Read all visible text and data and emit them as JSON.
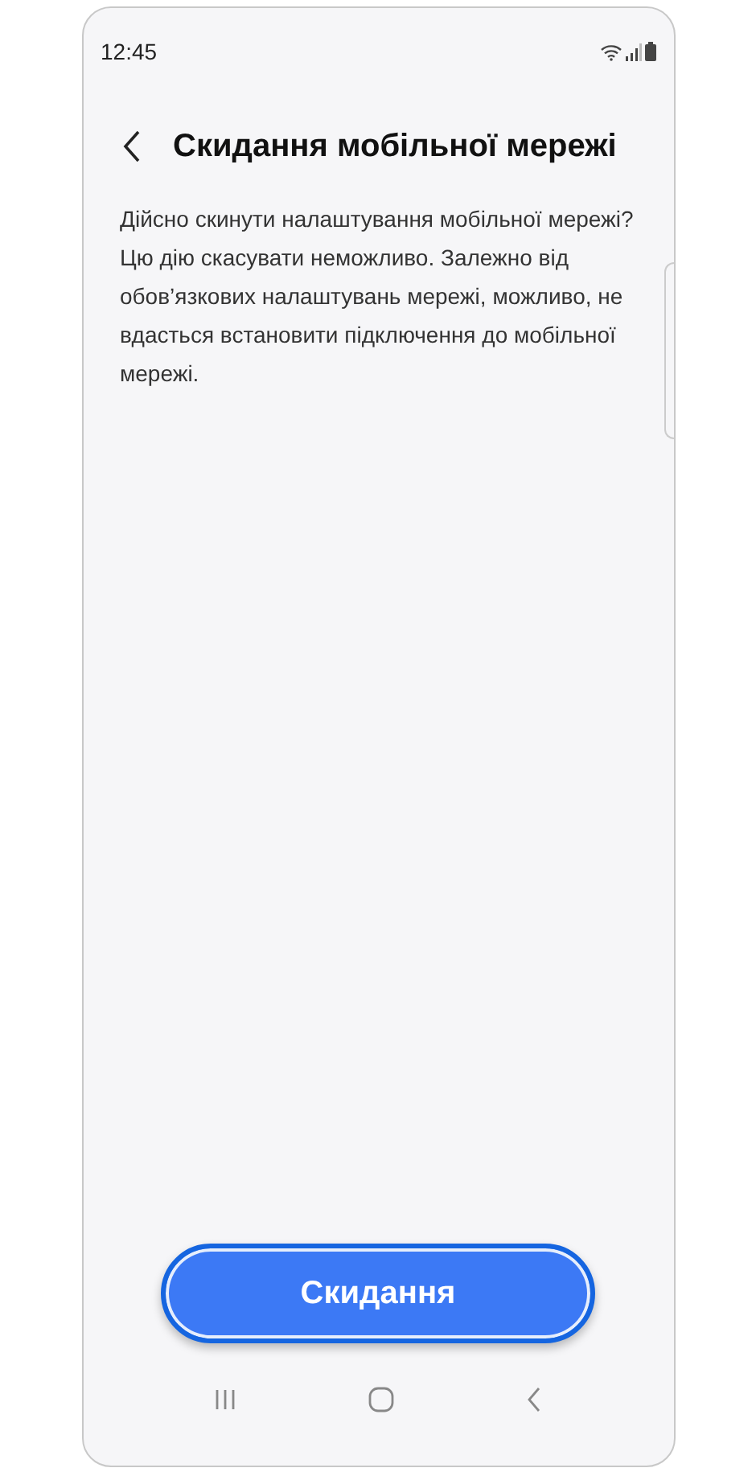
{
  "status_bar": {
    "time": "12:45"
  },
  "header": {
    "title": "Скидання мобільної мережі"
  },
  "message": "Дійсно скинути налаштування мобільної мережі? Цю дію скасувати неможливо. Залежно від обов’язкових налаштувань мережі, можливо, не вдасться встановити підключення до мобільної мережі.",
  "button": {
    "label": "Скидання"
  }
}
